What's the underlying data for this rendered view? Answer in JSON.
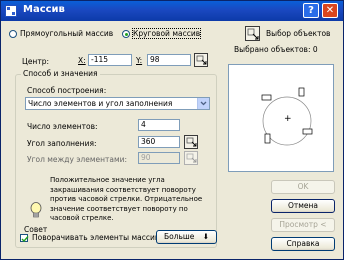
{
  "window": {
    "title": "Массив",
    "help_glyph": "?",
    "close_glyph": "✕"
  },
  "array_type": {
    "rect_label": "Прямоугольный массив",
    "polar_label": "Круговой массив",
    "selected": "polar"
  },
  "center": {
    "label": "Центр:",
    "x_label": "X:",
    "x_value": "-115",
    "y_label": "Y:",
    "y_value": "98"
  },
  "method_group": {
    "title": "Способ и значения",
    "construction_label": "Способ построения:",
    "construction_value": "Число элементов и угол заполнения",
    "count_label": "Число элементов:",
    "count_value": "4",
    "fill_angle_label": "Угол заполнения:",
    "fill_angle_value": "360",
    "between_angle_label": "Угол между элементами:",
    "between_angle_value": "90"
  },
  "tip": {
    "icon_label": "Совет",
    "text": "Положительное значение угла закрашивания соответствует повороту против часовой стрелки. Отрицательное значение соответствует повороту по часовой стрелке."
  },
  "rotate_items": {
    "label": "Поворачивать элементы массива",
    "checked": true
  },
  "more_button": {
    "label": "Больше",
    "glyph": "⬇"
  },
  "select_objects": {
    "button_label": "Выбор объектов",
    "count_text": "Выбрано объектов: 0"
  },
  "preview": {
    "element_count": 4,
    "center_marker": "+"
  },
  "buttons": {
    "ok": "OK",
    "cancel": "Отмена",
    "preview": "Просмотр <",
    "help": "Справка"
  },
  "colors": {
    "title_bar": "#0a5fd8",
    "dialog_bg": "#ece9d8",
    "close_button": "#d9451e"
  }
}
